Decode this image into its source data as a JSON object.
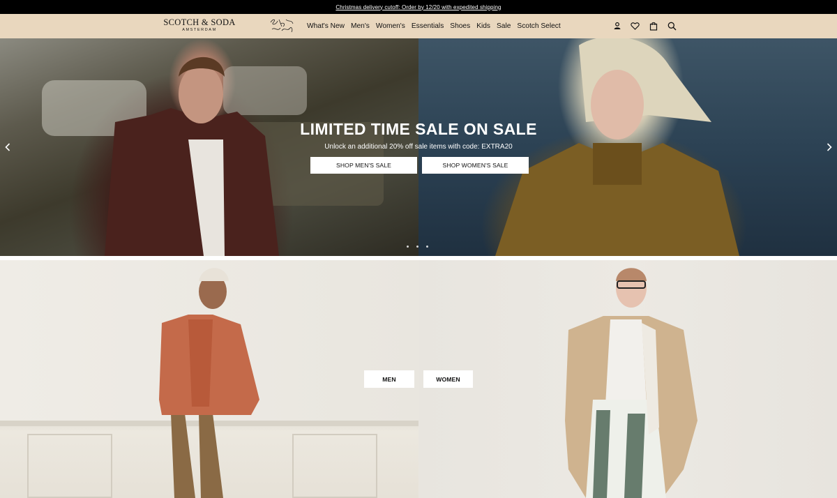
{
  "announcement": {
    "text": "Christmas delivery cutoff: Order by 12/20 with expedited shipping"
  },
  "header": {
    "logo_brand": "SCOTCH & SODA",
    "logo_city": "AMSTERDAM",
    "nav": [
      "What's New",
      "Men's",
      "Women's",
      "Essentials",
      "Shoes",
      "Kids",
      "Sale",
      "Scotch Select"
    ],
    "icons": [
      "account-icon",
      "wishlist-icon",
      "bag-icon",
      "search-icon"
    ]
  },
  "hero": {
    "title": "LIMITED TIME SALE ON SALE",
    "subtitle": "Unlock an additional 20% off sale items with code: EXTRA20",
    "buttons": [
      "SHOP MEN'S SALE",
      "SHOP WOMEN'S SALE"
    ],
    "slide_count": 3
  },
  "categories": {
    "men_label": "MEN",
    "women_label": "WOMEN"
  },
  "colors": {
    "header_bg": "#e9d7be",
    "announce_bg": "#000000",
    "button_bg": "#ffffff"
  }
}
